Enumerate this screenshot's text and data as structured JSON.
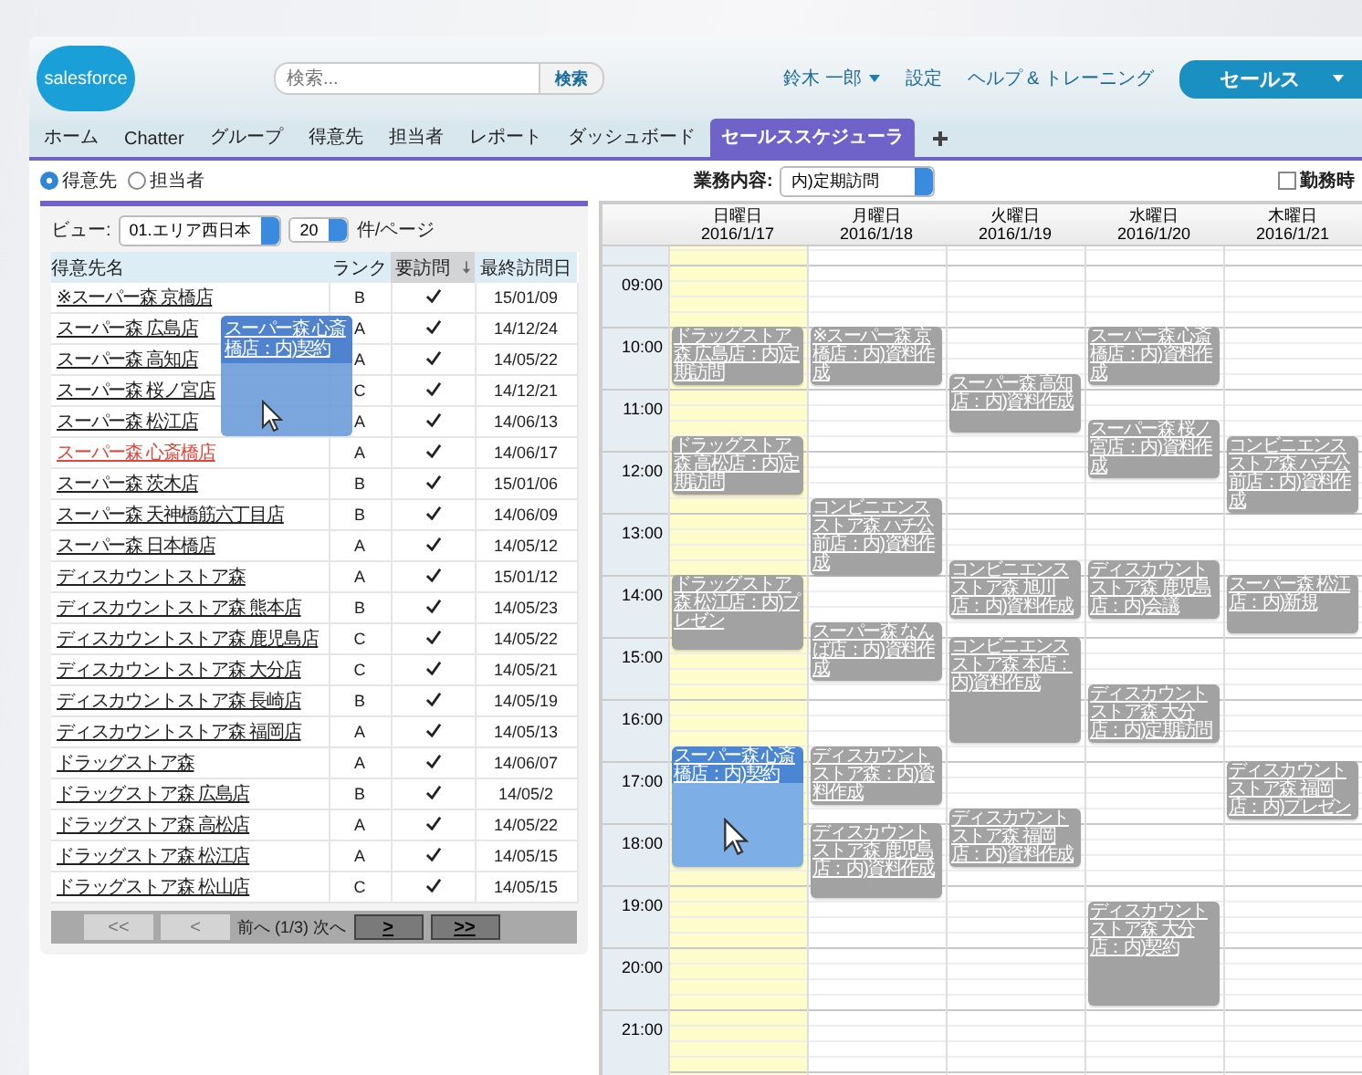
{
  "header": {
    "logo_text": "salesforce",
    "search": {
      "placeholder": "検索...",
      "button": "検索"
    },
    "user": "鈴木 一郎",
    "links": [
      "設定",
      "ヘルプ & トレーニング"
    ],
    "app_button": "セールス"
  },
  "tabs": [
    {
      "label": "ホーム",
      "selected": false
    },
    {
      "label": "Chatter",
      "selected": false
    },
    {
      "label": "グループ",
      "selected": false
    },
    {
      "label": "得意先",
      "selected": false
    },
    {
      "label": "担当者",
      "selected": false
    },
    {
      "label": "レポート",
      "selected": false
    },
    {
      "label": "ダッシュボード",
      "selected": false
    },
    {
      "label": "セールススケジューラ",
      "selected": true
    }
  ],
  "mode": [
    {
      "label": "得意先",
      "selected": true
    },
    {
      "label": "担当者",
      "selected": false
    }
  ],
  "list": {
    "view_label": "ビュー:",
    "view": "01.エリア西日本",
    "page_size": "20",
    "page_size_label": "件/ページ",
    "columns": [
      {
        "label": "得意先名",
        "sorted": false
      },
      {
        "label": "ランク",
        "sorted": false
      },
      {
        "label": "要訪問",
        "sorted": true
      },
      {
        "label": "最終訪問日",
        "sorted": false
      }
    ],
    "rows": [
      {
        "name": "※スーパー森 京橋店",
        "rank": "B",
        "visit_required": true,
        "last_visit": "15/01/09",
        "hovered": false
      },
      {
        "name": "スーパー森 広島店",
        "rank": "A",
        "visit_required": true,
        "last_visit": "14/12/24",
        "hovered": false
      },
      {
        "name": "スーパー森 高知店",
        "rank": "A",
        "visit_required": true,
        "last_visit": "14/05/22",
        "hovered": false
      },
      {
        "name": "スーパー森 桜ノ宮店",
        "rank": "C",
        "visit_required": true,
        "last_visit": "14/12/21",
        "hovered": false
      },
      {
        "name": "スーパー森 松江店",
        "rank": "A",
        "visit_required": true,
        "last_visit": "14/06/13",
        "hovered": false
      },
      {
        "name": "スーパー森 心斎橋店",
        "rank": "A",
        "visit_required": true,
        "last_visit": "14/06/17",
        "hovered": true
      },
      {
        "name": "スーパー森 茨木店",
        "rank": "B",
        "visit_required": true,
        "last_visit": "15/01/06",
        "hovered": false
      },
      {
        "name": "スーパー森 天神橋筋六丁目店",
        "rank": "B",
        "visit_required": true,
        "last_visit": "14/06/09",
        "hovered": false
      },
      {
        "name": "スーパー森 日本橋店",
        "rank": "A",
        "visit_required": true,
        "last_visit": "14/05/12",
        "hovered": false
      },
      {
        "name": "ディスカウントストア森",
        "rank": "A",
        "visit_required": true,
        "last_visit": "15/01/12",
        "hovered": false
      },
      {
        "name": "ディスカウントストア森 熊本店",
        "rank": "B",
        "visit_required": true,
        "last_visit": "14/05/23",
        "hovered": false
      },
      {
        "name": "ディスカウントストア森 鹿児島店",
        "rank": "C",
        "visit_required": true,
        "last_visit": "14/05/22",
        "hovered": false
      },
      {
        "name": "ディスカウントストア森 大分店",
        "rank": "C",
        "visit_required": true,
        "last_visit": "14/05/21",
        "hovered": false
      },
      {
        "name": "ディスカウントストア森 長崎店",
        "rank": "B",
        "visit_required": true,
        "last_visit": "14/05/19",
        "hovered": false
      },
      {
        "name": "ディスカウントストア森 福岡店",
        "rank": "A",
        "visit_required": true,
        "last_visit": "14/05/13",
        "hovered": false
      },
      {
        "name": "ドラッグストア森",
        "rank": "A",
        "visit_required": true,
        "last_visit": "14/06/07",
        "hovered": false
      },
      {
        "name": "ドラッグストア森 広島店",
        "rank": "B",
        "visit_required": true,
        "last_visit": "14/05/2",
        "hovered": false
      },
      {
        "name": "ドラッグストア森 高松店",
        "rank": "A",
        "visit_required": true,
        "last_visit": "14/05/22",
        "hovered": false
      },
      {
        "name": "ドラッグストア森 松江店",
        "rank": "A",
        "visit_required": true,
        "last_visit": "14/05/15",
        "hovered": false
      },
      {
        "name": "ドラッグストア森 松山店",
        "rank": "C",
        "visit_required": true,
        "last_visit": "14/05/15",
        "hovered": false
      }
    ],
    "drag_preview": {
      "text": "スーパー森 心斎橋店：内)契約"
    },
    "pager": [
      {
        "kind": "button",
        "label": "<<",
        "disabled": true
      },
      {
        "kind": "button",
        "label": "<",
        "disabled": true
      },
      {
        "kind": "text",
        "label": "前へ (1/3) 次へ"
      },
      {
        "kind": "button",
        "label": ">",
        "disabled": false
      },
      {
        "kind": "button",
        "label": ">>",
        "disabled": false
      }
    ]
  },
  "calendar": {
    "filter_label": "業務内容:",
    "filter": "内)定期訪問",
    "option": {
      "label": "勤務時",
      "checked": false
    },
    "hours": [
      "09:00",
      "10:00",
      "11:00",
      "12:00",
      "13:00",
      "14:00",
      "15:00",
      "16:00",
      "17:00",
      "18:00",
      "19:00",
      "20:00",
      "21:00"
    ],
    "days": [
      {
        "weekday": "日曜日",
        "date": "2016/1/17",
        "today": true,
        "events": [
          {
            "title": "ドラッグストア森 広島店：内)定期訪問",
            "selected": false
          },
          {
            "title": "ドラッグストア森 高松店：内)定期訪問",
            "selected": false
          },
          {
            "title": "ドラッグストア森 松江店：内)プレゼン",
            "selected": false
          },
          {
            "title": "スーパー森 心斎橋店：内)契約",
            "selected": true
          }
        ]
      },
      {
        "weekday": "月曜日",
        "date": "2016/1/18",
        "today": false,
        "events": [
          {
            "title": "※スーパー森 京橋店：内)資料作成",
            "selected": false
          },
          {
            "title": "コンビニエンスストア森 ハチ公前店：内)資料作成",
            "selected": false
          },
          {
            "title": "スーパー森 なんば店：内)資料作成",
            "selected": false
          },
          {
            "title": "ディスカウントストア森：内)資料作成",
            "selected": false
          },
          {
            "title": "ディスカウントストア森 鹿児島店：内)資料作成",
            "selected": false
          }
        ]
      },
      {
        "weekday": "火曜日",
        "date": "2016/1/19",
        "today": false,
        "events": [
          {
            "title": "スーパー森 高知店：内)資料作成",
            "selected": false
          },
          {
            "title": "コンビニエンスストア森 旭川店：内)資料作成",
            "selected": false
          },
          {
            "title": "コンビニエンスストア森 本店：内)資料作成",
            "selected": false
          },
          {
            "title": "ディスカウントストア森 福岡店：内)資料作成",
            "selected": false
          }
        ]
      },
      {
        "weekday": "水曜日",
        "date": "2016/1/20",
        "today": false,
        "events": [
          {
            "title": "スーパー森 心斎橋店：内)資料作成",
            "selected": false
          },
          {
            "title": "スーパー森 桜ノ宮店：内)資料作成",
            "selected": false
          },
          {
            "title": "ディスカウントストア森 鹿児島店：内)会議",
            "selected": false
          },
          {
            "title": "ディスカウントストア森 大分店：内)定期訪問",
            "selected": false
          },
          {
            "title": "ディスカウントストア森 大分店：内)契約",
            "selected": false
          }
        ]
      },
      {
        "weekday": "木曜日",
        "date": "2016/1/21",
        "today": false,
        "events": [
          {
            "title": "コンビニエンスストア森 ハチ公前店：内)資料作成",
            "selected": false
          },
          {
            "title": "スーパー森 松江店：内)新規",
            "selected": false
          },
          {
            "title": "ディスカウントストア森 福岡店：内)プレゼン",
            "selected": false
          }
        ]
      }
    ]
  }
}
